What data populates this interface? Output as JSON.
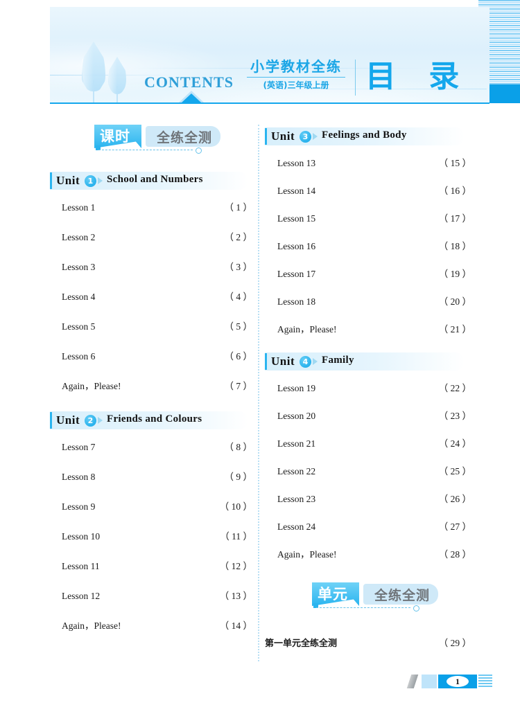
{
  "header": {
    "contents_label": "CONTENTS",
    "book_title": "小学教材全练",
    "book_subtitle": "(英语)三年级上册",
    "catalog_label": "目 录",
    "accent_color": "#14a7ec"
  },
  "sections": [
    {
      "badge_cn": "课时",
      "badge_gray": "全练全测"
    },
    {
      "badge_cn": "单元",
      "badge_gray": "全练全测"
    }
  ],
  "left_column": {
    "units": [
      {
        "unit_word": "Unit",
        "number": "1",
        "title": "School and Numbers",
        "entries": [
          {
            "name": "Lesson 1",
            "page": "（ 1 ）"
          },
          {
            "name": "Lesson 2",
            "page": "（ 2 ）"
          },
          {
            "name": "Lesson 3",
            "page": "（ 3 ）"
          },
          {
            "name": "Lesson 4",
            "page": "（ 4 ）"
          },
          {
            "name": "Lesson 5",
            "page": "（ 5 ）"
          },
          {
            "name": "Lesson 6",
            "page": "（ 6 ）"
          },
          {
            "name": "Again，Please!",
            "page": "（ 7 ）"
          }
        ]
      },
      {
        "unit_word": "Unit",
        "number": "2",
        "title": "Friends and Colours",
        "entries": [
          {
            "name": "Lesson 7",
            "page": "（ 8 ）"
          },
          {
            "name": "Lesson 8",
            "page": "（ 9 ）"
          },
          {
            "name": "Lesson 9",
            "page": "（ 10 ）"
          },
          {
            "name": "Lesson 10",
            "page": "（ 11 ）"
          },
          {
            "name": "Lesson 11",
            "page": "（ 12 ）"
          },
          {
            "name": "Lesson 12",
            "page": "（ 13 ）"
          },
          {
            "name": "Again，Please!",
            "page": "（ 14 ）"
          }
        ]
      }
    ]
  },
  "right_column": {
    "units": [
      {
        "unit_word": "Unit",
        "number": "3",
        "title": "Feelings and Body",
        "entries": [
          {
            "name": "Lesson 13",
            "page": "（ 15 ）"
          },
          {
            "name": "Lesson 14",
            "page": "（ 16 ）"
          },
          {
            "name": "Lesson 15",
            "page": "（ 17 ）"
          },
          {
            "name": "Lesson 16",
            "page": "（ 18 ）"
          },
          {
            "name": "Lesson 17",
            "page": "（ 19 ）"
          },
          {
            "name": "Lesson 18",
            "page": "（ 20 ）"
          },
          {
            "name": "Again，Please!",
            "page": "（ 21 ）"
          }
        ]
      },
      {
        "unit_word": "Unit",
        "number": "4",
        "title": "Family",
        "entries": [
          {
            "name": "Lesson 19",
            "page": "（ 22 ）"
          },
          {
            "name": "Lesson 20",
            "page": "（ 23 ）"
          },
          {
            "name": "Lesson 21",
            "page": "（ 24 ）"
          },
          {
            "name": "Lesson 22",
            "page": "（ 25 ）"
          },
          {
            "name": "Lesson 23",
            "page": "（ 26 ）"
          },
          {
            "name": "Lesson 24",
            "page": "（ 27 ）"
          },
          {
            "name": "Again，Please!",
            "page": "（ 28 ）"
          }
        ]
      }
    ],
    "unit_test_entries": [
      {
        "name": "第一单元全练全测",
        "page": "（ 29 ）"
      }
    ]
  },
  "footer": {
    "page_number": "1"
  }
}
